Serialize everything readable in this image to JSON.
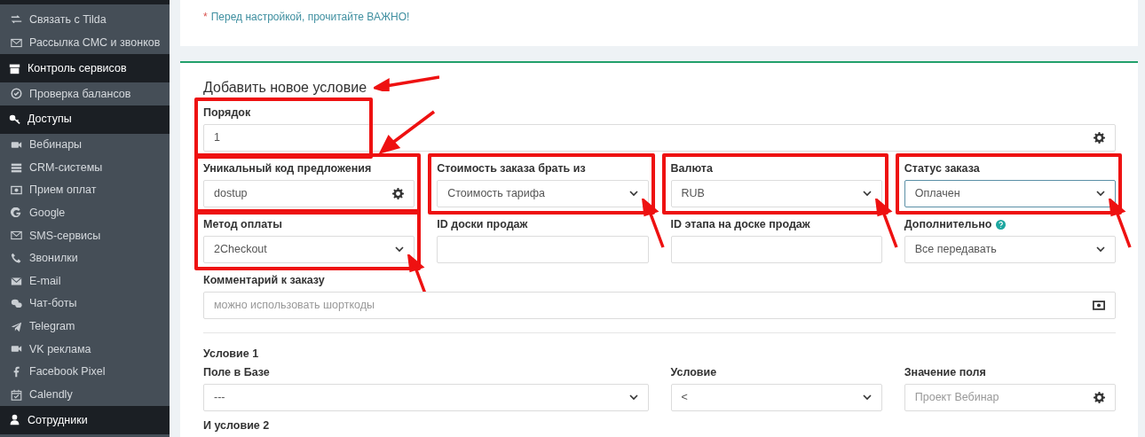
{
  "sidebar": {
    "items": [
      {
        "label": "Связать с Tilda",
        "kind": "item"
      },
      {
        "label": "Рассылка СМС и звонков",
        "kind": "item"
      },
      {
        "label": "Контроль сервисов",
        "kind": "section"
      },
      {
        "label": "Проверка балансов",
        "kind": "item"
      },
      {
        "label": "Доступы",
        "kind": "section"
      },
      {
        "label": "Вебинары",
        "kind": "item"
      },
      {
        "label": "CRM-системы",
        "kind": "item"
      },
      {
        "label": "Прием оплат",
        "kind": "item"
      },
      {
        "label": "Google",
        "kind": "item"
      },
      {
        "label": "SMS-сервисы",
        "kind": "item"
      },
      {
        "label": "Звонилки",
        "kind": "item"
      },
      {
        "label": "E-mail",
        "kind": "item"
      },
      {
        "label": "Чат-боты",
        "kind": "item"
      },
      {
        "label": "Telegram",
        "kind": "item"
      },
      {
        "label": "VK реклама",
        "kind": "item"
      },
      {
        "label": "Facebook Pixel",
        "kind": "item"
      },
      {
        "label": "Calendly",
        "kind": "item"
      },
      {
        "label": "Сотрудники",
        "kind": "section"
      }
    ]
  },
  "notice": {
    "mark": "*",
    "link": "Перед настройкой, прочитайте ВАЖНО!"
  },
  "form": {
    "title": "Добавить новое условие",
    "title_arrow": true,
    "rows": [
      [
        {
          "label": "Порядок",
          "kind": "input-gear",
          "value": "1",
          "highlighted": true,
          "arrow": false,
          "focused": false,
          "help": false
        }
      ],
      [
        {
          "label": "Уникальный код предложения",
          "kind": "input-gear",
          "value": "dostup",
          "highlighted": true,
          "arrow": true,
          "focused": false,
          "help": false
        },
        {
          "label": "Стоимость заказа брать из",
          "kind": "select",
          "value": "Стоимость тарифа",
          "highlighted": true,
          "arrow": true,
          "focused": false,
          "help": false
        },
        {
          "label": "Валюта",
          "kind": "select",
          "value": "RUB",
          "highlighted": true,
          "arrow": true,
          "focused": false,
          "help": false
        },
        {
          "label": "Статус заказа",
          "kind": "select",
          "value": "Оплачен",
          "highlighted": true,
          "arrow": true,
          "focused": true,
          "help": false
        }
      ],
      [
        {
          "label": "Метод оплаты",
          "kind": "select",
          "value": "2Checkout",
          "highlighted": true,
          "arrow": true,
          "focused": false,
          "help": false
        },
        {
          "label": "ID доски продаж",
          "kind": "input",
          "highlighted": false,
          "arrow": false,
          "focused": false,
          "help": false
        },
        {
          "label": "ID этапа на доске продаж",
          "kind": "input",
          "highlighted": false,
          "arrow": false,
          "focused": false,
          "help": false
        },
        {
          "label": "Дополнительно",
          "kind": "select",
          "value": "Все передавать",
          "highlighted": false,
          "arrow": false,
          "focused": false,
          "help": true
        }
      ],
      [
        {
          "label": "Комментарий к заказу",
          "kind": "input-code",
          "placeholder": "можно использовать шорткоды",
          "highlighted": false,
          "arrow": false,
          "focused": false,
          "help": false
        }
      ]
    ],
    "conditions": [
      {
        "title": "Условие 1",
        "fields": [
          {
            "label": "Поле в Базе",
            "kind": "select",
            "value": "---",
            "highlighted": false,
            "arrow": false,
            "focused": false,
            "help": false
          },
          {
            "label": "Условие",
            "kind": "select",
            "value": "<",
            "highlighted": false,
            "arrow": false,
            "focused": false,
            "help": false
          },
          {
            "label": "Значение поля",
            "kind": "input-gear",
            "placeholder": "Проект Вебинар",
            "highlighted": false,
            "arrow": false,
            "focused": false,
            "help": false
          }
        ]
      },
      {
        "title": "И условие 2"
      }
    ]
  }
}
